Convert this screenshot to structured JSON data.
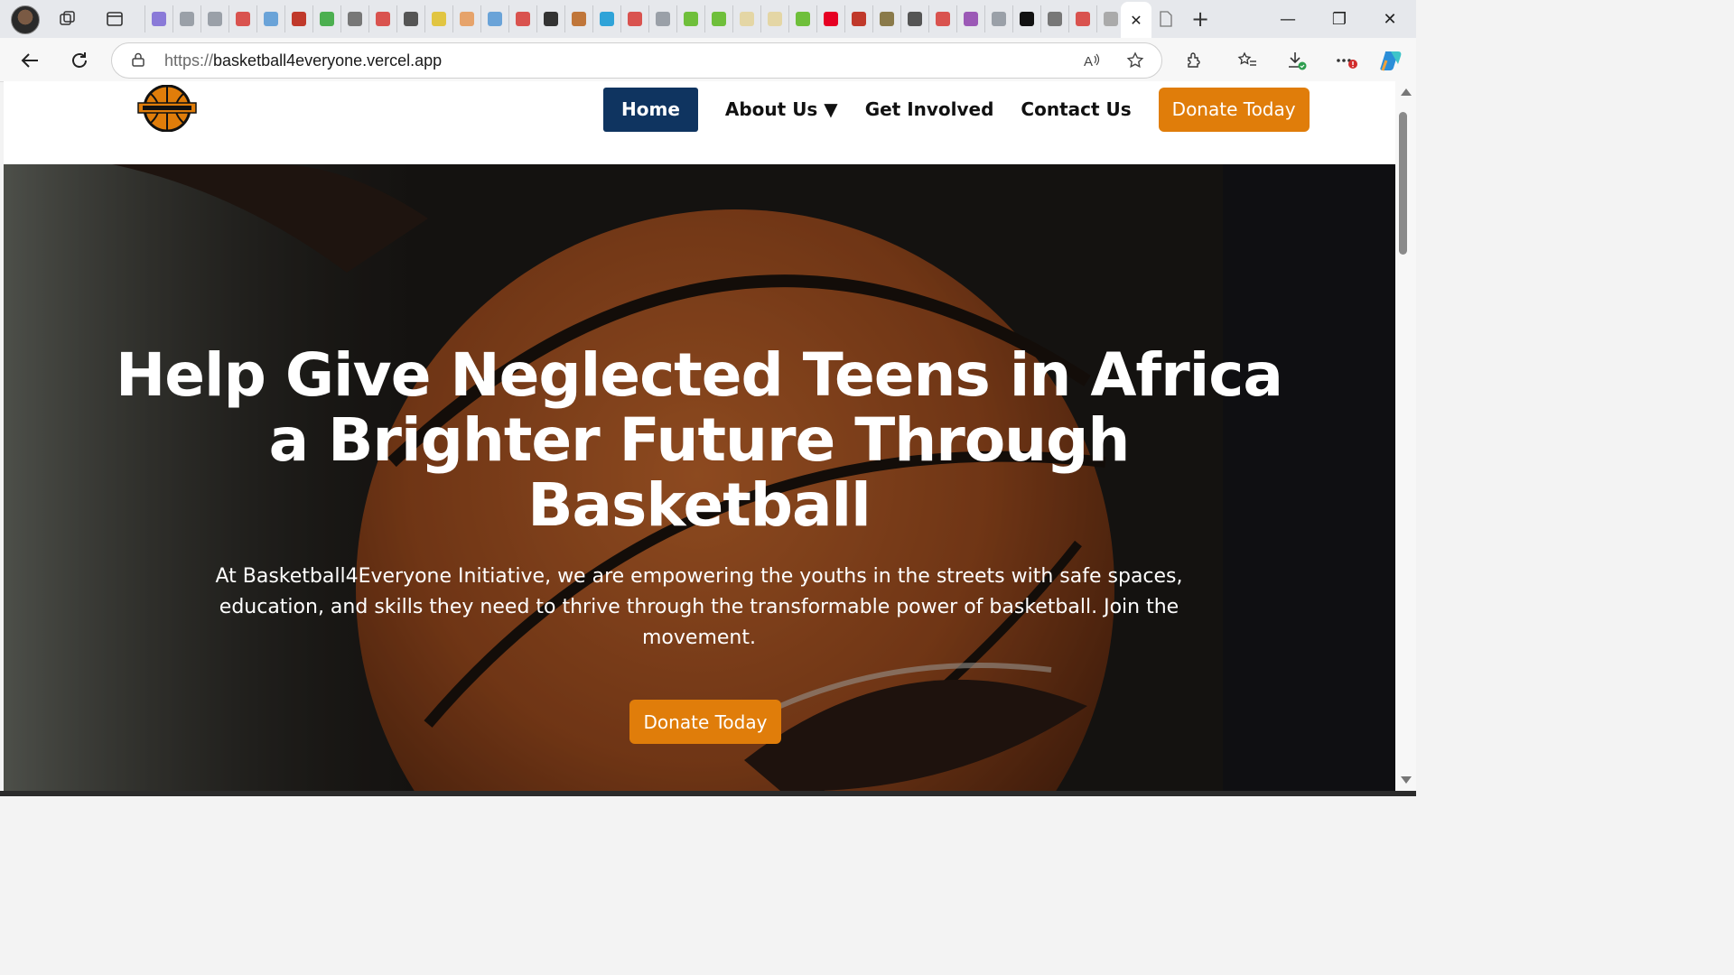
{
  "browser": {
    "tab_close_glyph": "✕",
    "new_tab_glyph": "+",
    "minimize_glyph": "—",
    "restore_glyph": "❐",
    "close_glyph": "✕",
    "favicons": [
      {
        "name": "copilot-favicon",
        "color": "#8a7ad8"
      },
      {
        "name": "search-favicon",
        "color": "#9aa0a8"
      },
      {
        "name": "search-favicon",
        "color": "#9aa0a8"
      },
      {
        "name": "pdf-favicon",
        "color": "#d9534f"
      },
      {
        "name": "wave-favicon",
        "color": "#6aa3d8"
      },
      {
        "name": "pdf-favicon",
        "color": "#c0392b"
      },
      {
        "name": "w-favicon",
        "color": "#4caf50"
      },
      {
        "name": "doc-favicon",
        "color": "#777777"
      },
      {
        "name": "pdf-favicon",
        "color": "#d9534f"
      },
      {
        "name": "notion-favicon",
        "color": "#555555"
      },
      {
        "name": "v-favicon",
        "color": "#e1c542"
      },
      {
        "name": "hand-favicon",
        "color": "#e6a36b"
      },
      {
        "name": "wave-favicon",
        "color": "#6aa3d8"
      },
      {
        "name": "pdf-favicon",
        "color": "#d9534f"
      },
      {
        "name": "github-favicon",
        "color": "#333333"
      },
      {
        "name": "globe-favicon",
        "color": "#c0763a"
      },
      {
        "name": "edge-favicon",
        "color": "#2fa3d8"
      },
      {
        "name": "pdf-favicon",
        "color": "#d9534f"
      },
      {
        "name": "search-favicon",
        "color": "#9aa0a8"
      },
      {
        "name": "upwork-favicon",
        "color": "#6fbf3b"
      },
      {
        "name": "upwork-favicon",
        "color": "#6fbf3b"
      },
      {
        "name": "circle-favicon",
        "color": "#e4d6a5"
      },
      {
        "name": "circle-favicon",
        "color": "#e4d6a5"
      },
      {
        "name": "upwork-favicon",
        "color": "#6fbf3b"
      },
      {
        "name": "pinterest-favicon",
        "color": "#e60023"
      },
      {
        "name": "b-favicon",
        "color": "#c0392b"
      },
      {
        "name": "s-favicon",
        "color": "#8a7a4a"
      },
      {
        "name": "question-favicon",
        "color": "#555555"
      },
      {
        "name": "pdf-favicon",
        "color": "#d9534f"
      },
      {
        "name": "v-favicon",
        "color": "#9b59b6"
      },
      {
        "name": "search-favicon",
        "color": "#9aa0a8"
      },
      {
        "name": "up-favicon",
        "color": "#111111"
      },
      {
        "name": "doc-favicon",
        "color": "#777777"
      },
      {
        "name": "pdf-favicon",
        "color": "#d9534f"
      },
      {
        "name": "page-favicon",
        "color": "#aaaaaa"
      }
    ],
    "url_scheme": "https://",
    "url_host": "basketball4everyone.vercel.app"
  },
  "site": {
    "nav": {
      "home": "Home",
      "about": "About Us ▼",
      "get_involved": "Get Involved",
      "contact": "Contact Us",
      "donate": "Donate Today"
    },
    "hero": {
      "title": "Help Give Neglected Teens in Africa a Brighter Future Through Basketball",
      "text": "At Basketball4Everyone Initiative, we are empowering the youths in the streets with safe spaces, education, and skills they need to thrive through the transformable power of basketball. Join the movement.",
      "cta": "Donate Today"
    },
    "colors": {
      "primary_navy": "#0f3460",
      "accent_orange": "#e07d0a"
    }
  }
}
